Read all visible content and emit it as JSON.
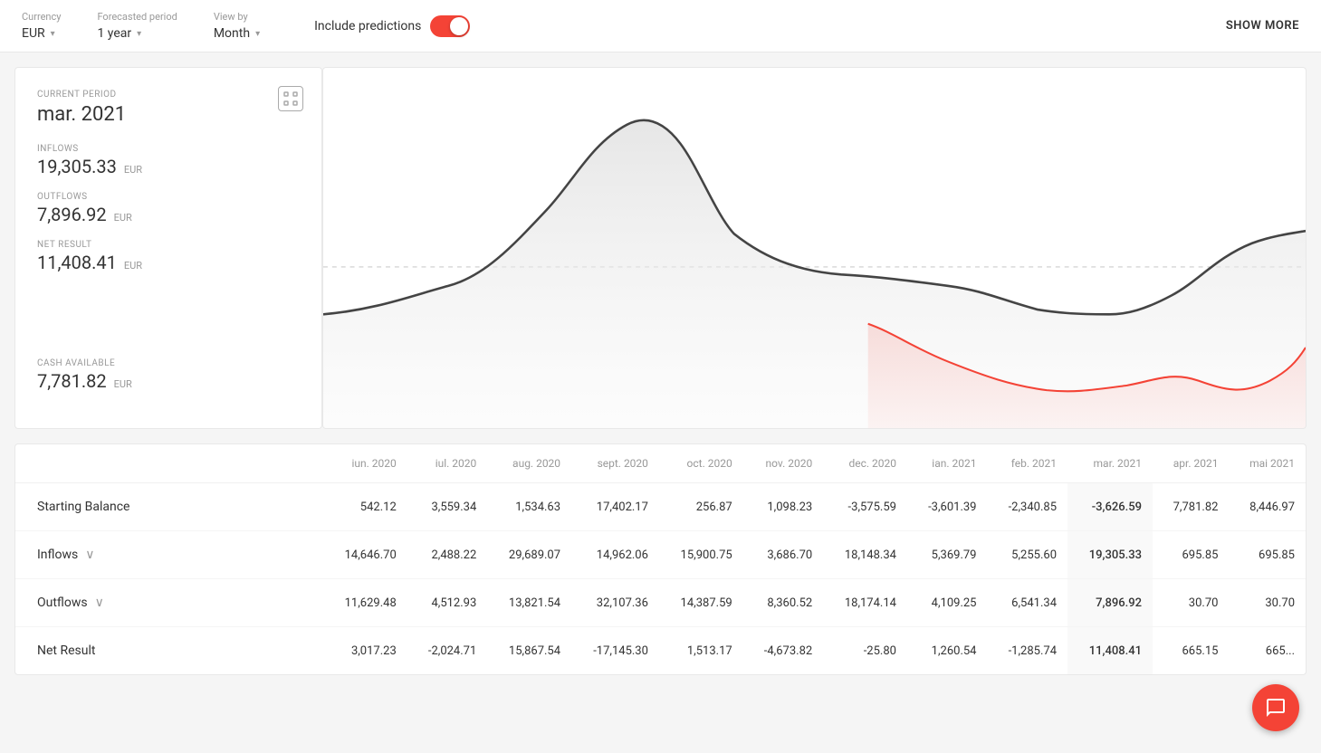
{
  "topbar": {
    "currency_label": "Currency",
    "currency_value": "EUR",
    "forecasted_label": "Forecasted period",
    "forecasted_value": "1 year",
    "viewby_label": "View by",
    "viewby_value": "Month",
    "predictions_label": "Include predictions",
    "show_more": "SHOW MORE"
  },
  "leftpanel": {
    "current_period_label": "CURRENT PERIOD",
    "current_period": "mar. 2021",
    "inflows_label": "INFLOWS",
    "inflows_value": "19,305.33",
    "inflows_currency": "EUR",
    "outflows_label": "OUTFLOWS",
    "outflows_value": "7,896.92",
    "outflows_currency": "EUR",
    "net_result_label": "NET RESULT",
    "net_result_value": "11,408.41",
    "net_result_currency": "EUR",
    "cash_label": "CASH AVAILABLE",
    "cash_value": "7,781.82",
    "cash_currency": "EUR"
  },
  "table": {
    "columns": [
      "",
      "iun. 2020",
      "iul. 2020",
      "aug. 2020",
      "sept. 2020",
      "oct. 2020",
      "nov. 2020",
      "dec. 2020",
      "ian. 2021",
      "feb. 2021",
      "mar. 2021",
      "apr. 2021",
      "mai 2021"
    ],
    "rows": [
      {
        "label": "Starting Balance",
        "expandable": false,
        "values": [
          "542.12",
          "3,559.34",
          "1,534.63",
          "17,402.17",
          "256.87",
          "1,098.23",
          "-3,575.59",
          "-3,601.39",
          "-2,340.85",
          "-3,626.59",
          "7,781.82",
          "8,446.97"
        ]
      },
      {
        "label": "Inflows",
        "expandable": true,
        "values": [
          "14,646.70",
          "2,488.22",
          "29,689.07",
          "14,962.06",
          "15,900.75",
          "3,686.70",
          "18,148.34",
          "5,369.79",
          "5,255.60",
          "19,305.33",
          "695.85",
          "695.85"
        ]
      },
      {
        "label": "Outflows",
        "expandable": true,
        "values": [
          "11,629.48",
          "4,512.93",
          "13,821.54",
          "32,107.36",
          "14,387.59",
          "8,360.52",
          "18,174.14",
          "4,109.25",
          "6,541.34",
          "7,896.92",
          "30.70",
          "30.70"
        ]
      },
      {
        "label": "Net Result",
        "expandable": false,
        "values": [
          "3,017.23",
          "-2,024.71",
          "15,867.54",
          "-17,145.30",
          "1,513.17",
          "-4,673.82",
          "-25.80",
          "1,260.54",
          "-1,285.74",
          "11,408.41",
          "665.15",
          "665..."
        ]
      }
    ]
  }
}
